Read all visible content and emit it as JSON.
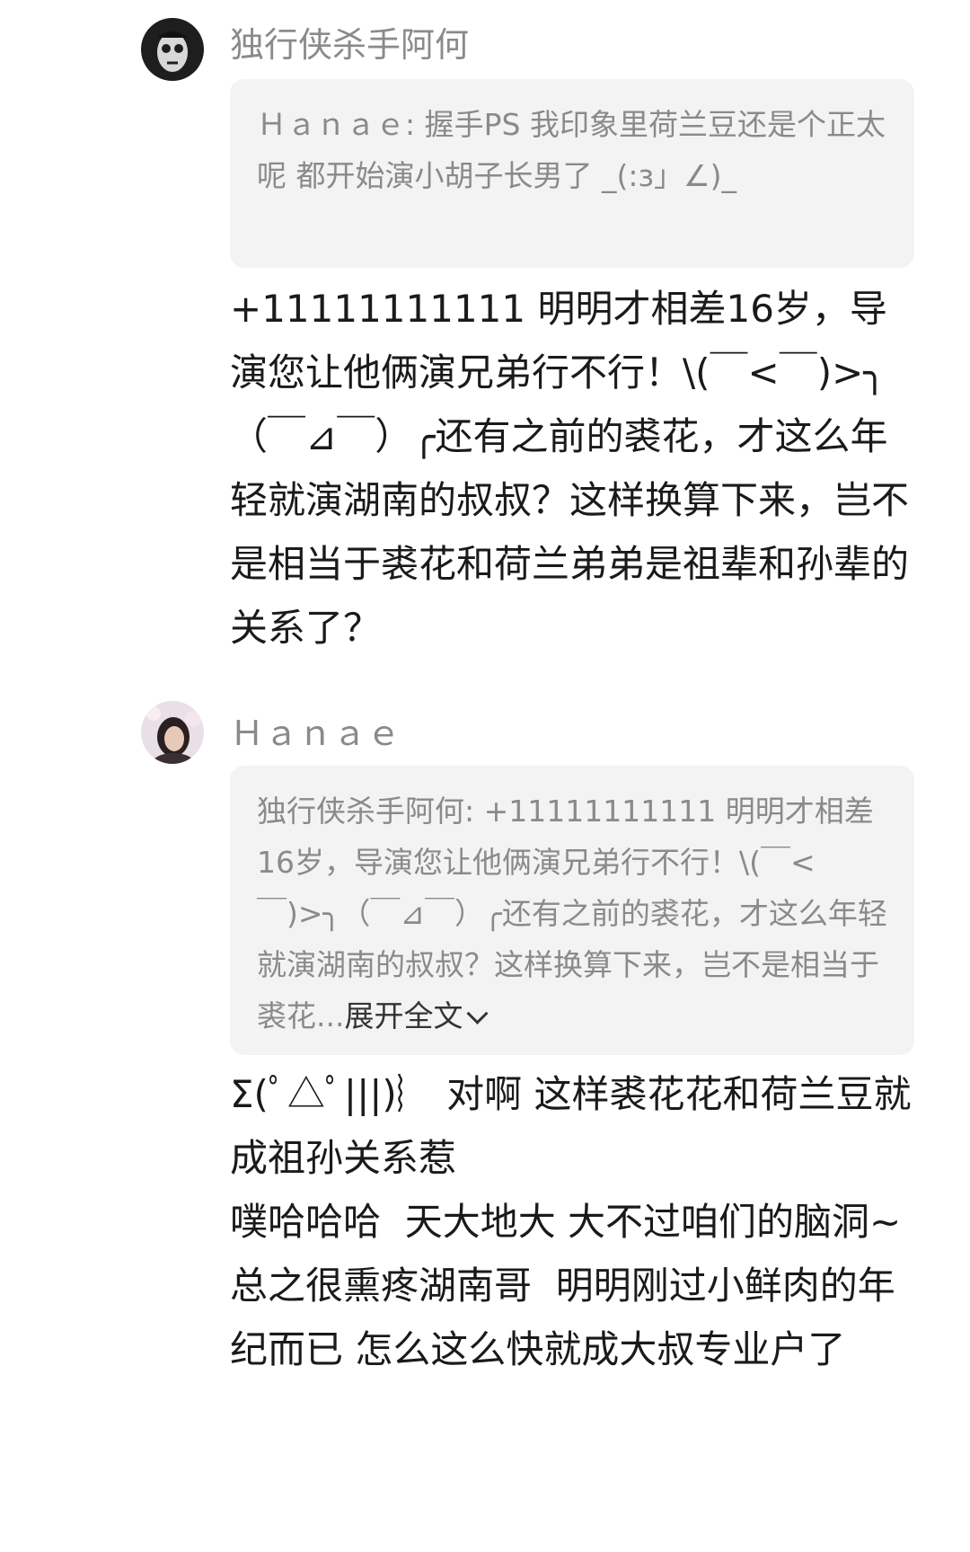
{
  "comments": [
    {
      "username": "独行侠杀手阿何",
      "avatar_icon": "skull-face-avatar",
      "quote": {
        "author": "Ｈａｎａｅ",
        "text": "握手PS 我印象里荷兰豆还是个正太呢  都开始演小胡子长男了  _(:з」∠)_"
      },
      "body": "+11111111111 明明才相差16岁，导演您让他俩演兄弟行不行！\\(￣<￣)>╮（￣⊿￣）╭还有之前的裘花，才这么年轻就演湖南的叔叔？这样换算下来，岂不是相当于裘花和荷兰弟弟是祖辈和孙辈的关系了？"
    },
    {
      "username": "Ｈａｎａｅ",
      "avatar_icon": "woman-photo-avatar",
      "quote": {
        "author": "独行侠杀手阿何",
        "text": "+11111111111 明明才相差16岁，导演您让他俩演兄弟行不行！\\(￣<￣)>╮（￣⊿￣）╭还有之前的裘花，才这么年轻就演湖南的叔叔？这样换算下来，岂不是相当于裘花...",
        "expand_label": "展开全文"
      },
      "body_lines": [
        "Σ(ﾟ△ﾟ|||)︴ 对啊 这样裘花花和荷兰豆就成祖孙关系惹",
        "噗哈哈哈  天大地大 大不过咱们的脑洞~",
        "总之很熏疼湖南哥  明明刚过小鲜肉的年纪而已 怎么这么快就成大叔专业户了"
      ]
    }
  ]
}
